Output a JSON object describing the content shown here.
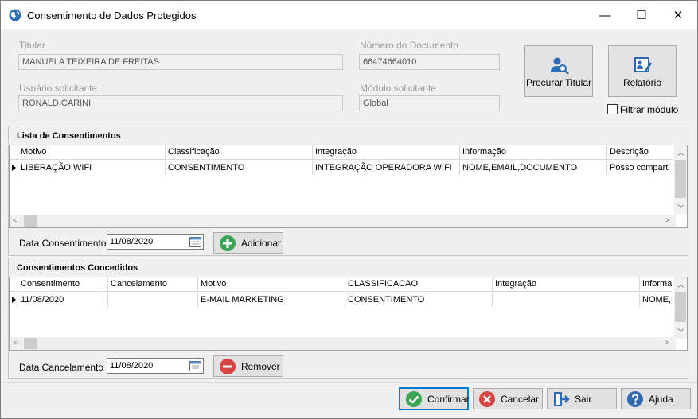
{
  "window": {
    "title": "Consentimento de Dados Protegidos",
    "minimize_label": "—",
    "maximize_label": "☐",
    "close_label": "✕"
  },
  "form": {
    "titular_label": "Titular",
    "titular_value": "MANUELA TEIXEIRA DE FREITAS",
    "documento_label": "Número do Documento",
    "documento_value": "66474664010",
    "usuario_label": "Usuário solicitante",
    "usuario_value": "RONALD.CARINI",
    "modulo_label": "Módulo solicitante",
    "modulo_value": "Global"
  },
  "actions": {
    "procurar_label": "Procurar Titular",
    "relatorio_label": "Relatório",
    "filtrar_label": "Filtrar módulo",
    "filtrar_checked": false
  },
  "lista": {
    "title": "Lista de Consentimentos",
    "columns": [
      "Motivo",
      "Classificação",
      "Integração",
      "Informação",
      "Descrição"
    ],
    "rows": [
      [
        "LIBERAÇÃO WIFI",
        "CONSENTIMENTO",
        "INTEGRAÇÃO OPERADORA WIFI",
        "NOME,EMAIL,DOCUMENTO",
        "Posso comparti"
      ]
    ],
    "date_label": "Data Consentimento",
    "date_value": "11/08/2020",
    "add_label": "Adicionar"
  },
  "concedidos": {
    "title": "Consentimentos Concedidos",
    "columns": [
      "Consentimento",
      "Cancelamento",
      "Motivo",
      "CLASSIFICACAO",
      "Integração",
      "Informa"
    ],
    "rows": [
      [
        "11/08/2020",
        "",
        "E-MAIL MARKETING",
        "CONSENTIMENTO",
        "",
        "NOME,E"
      ]
    ],
    "date_label": "Data Cancelamento",
    "date_value": "11/08/2020",
    "remove_label": "Remover"
  },
  "footer": {
    "confirmar": "Confirmar",
    "cancelar": "Cancelar",
    "sair": "Sair",
    "ajuda": "Ajuda"
  },
  "colors": {
    "accent": "#0078d7",
    "add_green": "#3aa655",
    "remove_red": "#d64541",
    "help_blue": "#3169b5"
  }
}
